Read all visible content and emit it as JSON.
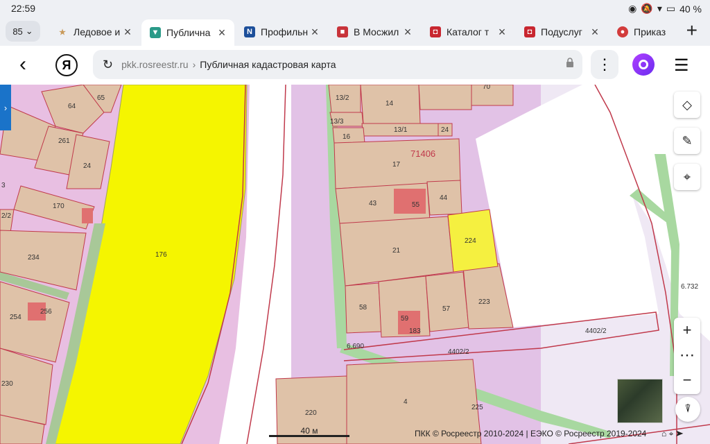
{
  "status": {
    "time": "22:59",
    "battery": "40 %"
  },
  "tabs": {
    "count": "85",
    "items": [
      {
        "title": "Ледовое и",
        "color": "#c99a5a",
        "glyph": "★"
      },
      {
        "title": "Публична",
        "color": "#2a9a88",
        "glyph": "▼",
        "active": true
      },
      {
        "title": "Профильн",
        "color": "#1d4f9a",
        "glyph": "N"
      },
      {
        "title": "В Мосжил",
        "color": "#c8333a",
        "glyph": "■"
      },
      {
        "title": "Каталог т",
        "color": "#c8262f",
        "glyph": "◘"
      },
      {
        "title": "Подуслуг",
        "color": "#c8262f",
        "glyph": "◘"
      },
      {
        "title": "Приказ",
        "color": "#d23c3c",
        "glyph": "●"
      }
    ]
  },
  "toolbar": {
    "ya_label": "Я",
    "domain": "pkk.rosreestr.ru",
    "separator": "›",
    "page_title": "Публичная кадастровая карта"
  },
  "map": {
    "block_label": "71406",
    "parcel_labels": [
      "64",
      "65",
      "261",
      "24",
      "170",
      "2/2",
      "234",
      "254",
      "256",
      "230",
      "176",
      "13/2",
      "14",
      "70",
      "13/3",
      "13/1",
      "16",
      "24",
      "17",
      "43",
      "55",
      "44",
      "21",
      "224",
      "58",
      "59",
      "183",
      "57",
      "223",
      "4402/2",
      "4402/2",
      "220",
      "4",
      "225",
      "3"
    ],
    "road_labels": [
      "6.690",
      "6.732"
    ],
    "scale_label": "40 м",
    "copyright": "ПКК © Росреестр 2010-2024 | ЕЭКО © Росреестр 2019-2024"
  }
}
